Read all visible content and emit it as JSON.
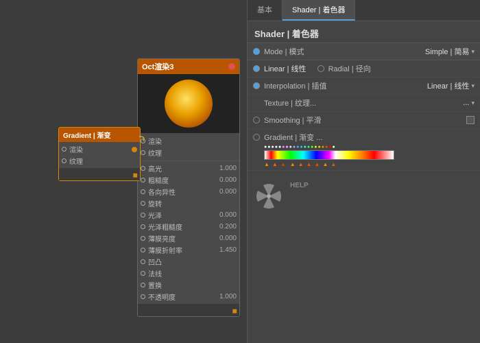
{
  "tabs": {
    "left": "基本",
    "right": "Shader | 着色器",
    "active": "right"
  },
  "panel": {
    "title": "Shader | 着色器",
    "mode_label": "Mode | 模式",
    "mode_value": "Simple | 简易",
    "linear_label": "Linear | 线性",
    "radial_label": "Radial | 径向",
    "interp_label": "Interpolation | 插值",
    "interp_value": "Linear | 线性",
    "texture_label": "Texture | 纹理...",
    "texture_value": "...",
    "smoothing_label": "Smoothing | 平滑",
    "gradient_label": "Gradient | 渐变 ...",
    "help_label": "HELP"
  },
  "nodes": {
    "oct": {
      "title": "Oct渲染3",
      "rows": [
        {
          "label": "渲染",
          "has_input": true
        },
        {
          "label": "纹理",
          "has_input": false
        }
      ],
      "params": [
        {
          "label": "高光",
          "value": "1.000"
        },
        {
          "label": "粗糙度",
          "value": "0.000"
        },
        {
          "label": "各向异性",
          "value": "0.000"
        },
        {
          "label": "旋转",
          "value": ""
        },
        {
          "label": "光泽",
          "value": "0.000"
        },
        {
          "label": "光泽粗糙度",
          "value": "0.200"
        },
        {
          "label": "薄膜亮度",
          "value": "0.000"
        },
        {
          "label": "薄膜折射率",
          "value": "1.450"
        },
        {
          "label": "凹凸",
          "value": ""
        },
        {
          "label": "法线",
          "value": ""
        },
        {
          "label": "置换",
          "value": ""
        },
        {
          "label": "不透明度",
          "value": "1.000"
        }
      ]
    },
    "gradient": {
      "title": "Gradient | 渐变",
      "rows": [
        {
          "label": "渲染"
        },
        {
          "label": "纹理"
        }
      ]
    }
  }
}
